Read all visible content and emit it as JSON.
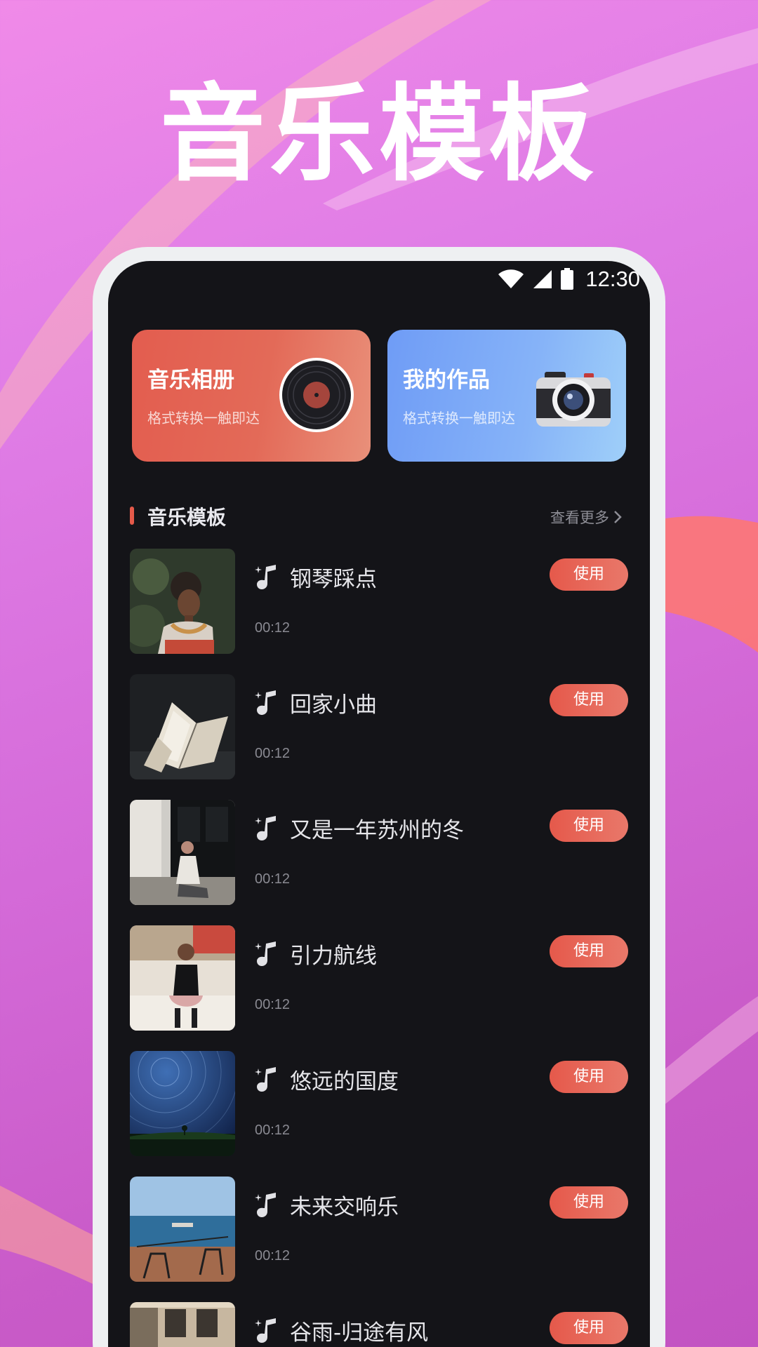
{
  "headline": "音乐模板",
  "status_bar": {
    "time": "12:30",
    "icons": [
      "wifi-icon",
      "signal-icon",
      "battery-icon"
    ]
  },
  "cards": [
    {
      "title": "音乐相册",
      "subtitle": "格式转换一触即达",
      "icon": "vinyl-record-icon"
    },
    {
      "title": "我的作品",
      "subtitle": "格式转换一触即达",
      "icon": "camera-icon"
    }
  ],
  "section": {
    "title": "音乐模板",
    "more_label": "查看更多"
  },
  "templates": [
    {
      "name": "钢琴踩点",
      "duration": "00:12",
      "action": "使用"
    },
    {
      "name": "回家小曲",
      "duration": "00:12",
      "action": "使用"
    },
    {
      "name": "又是一年苏州的冬",
      "duration": "00:12",
      "action": "使用"
    },
    {
      "name": "引力航线",
      "duration": "00:12",
      "action": "使用"
    },
    {
      "name": "悠远的国度",
      "duration": "00:12",
      "action": "使用"
    },
    {
      "name": "未来交响乐",
      "duration": "00:12",
      "action": "使用"
    },
    {
      "name": "谷雨-归途有风",
      "duration": "",
      "action": "使用"
    }
  ],
  "colors": {
    "accent": "#e5594b",
    "screen_bg": "#141418",
    "card_blue": "#7aa6f7"
  }
}
